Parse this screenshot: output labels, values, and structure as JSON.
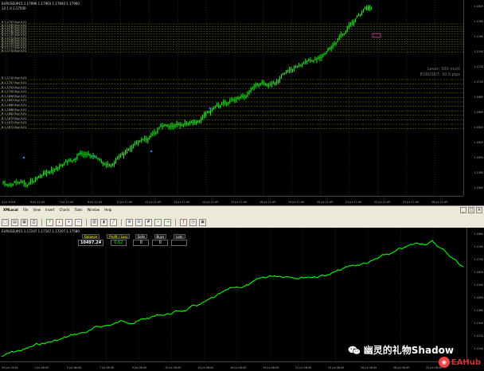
{
  "top_chart": {
    "symbol_line": "EURUSD,M15 1.17896 1.17903 1.17893 1.17900",
    "symbol_line2": "13.1 d  1.17500",
    "levels": [
      {
        "label": "B 1.1752 Buy 0.01"
      },
      {
        "label": "B 1.1749 Buy 0.01"
      },
      {
        "label": "B 1.1745 Buy 0.01"
      },
      {
        "label": "B 1.1742 Buy 0.01"
      },
      {
        "label": "B 1.1738 Buy 0.01"
      },
      {
        "label": "B 1.1735 Buy 0.01"
      },
      {
        "label": "B 1.1731 Buy 0.01"
      },
      {
        "label": "B 1.1728 Buy 0.01"
      },
      {
        "label": "B 1.1724 Buy 0.01"
      },
      {
        "label": "B 1.1721 Buy 0.01"
      },
      {
        "label": "B 1.1717 Buy 0.01"
      },
      {
        "label": "B 1.1714 Buy 0.01"
      },
      {
        "label": "B 1.1710 Buy 0.01"
      },
      {
        "label": "B 1.1707 Buy 0.01"
      },
      {
        "label": "B 1.1703 Buy 0.01"
      },
      {
        "label": "B 1.1700 Buy 0.01"
      },
      {
        "label": "B 1.1696 Buy 0.01"
      },
      {
        "label": "B 1.1693 Buy 0.01"
      },
      {
        "label": "B 1.1689 Buy 0.01"
      },
      {
        "label": "B 1.1686 Buy 0.01"
      },
      {
        "label": "B 1.1682 Buy 0.01"
      },
      {
        "label": "B 1.1679 Buy 0.01"
      },
      {
        "label": "B 1.1675 Buy 0.01"
      },
      {
        "label": "B 1.1672 Buy 0.01"
      }
    ],
    "overlay_line1": "Lever: 500 multi",
    "overlay_line2": "EURUSD7: 30.0 pips",
    "price_ticks": [
      "1.1800",
      "1.1780",
      "1.1760",
      "1.1740",
      "1.1720",
      "1.1700",
      "1.1680",
      "1.1660",
      "1.1640",
      "1.1620",
      "1.1600",
      "1.1580",
      "1.1560"
    ],
    "time_ticks": [
      "4 Jul 2016",
      "6 Jul 11:45",
      "7 Jul 11:45",
      "8 Jul 11:45",
      "11 Jul 11:45",
      "12 Jul 11:45",
      "13 Jul 11:45",
      "14 Jul 11:45",
      "15 Jul 11:45",
      "18 Jul 11:45",
      "19 Jul 11:45",
      "20 Jul 11:45",
      "21 Jul 11:45",
      "22 Jul 11:45",
      "25 Jul 11:45",
      "26 Jul 11:45"
    ],
    "colors": {
      "candles": "#00ff00",
      "grid": "#2a5a2a",
      "level": "#a6a61a",
      "blue_marker": "#3b6cff",
      "pink_marker": "#d033b0"
    }
  },
  "toolbar": {
    "window_title": "XMLocal",
    "menu": [
      "File",
      "View",
      "Insert",
      "Charts",
      "Tools",
      "Window",
      "Help"
    ],
    "icons": [
      "new-chart-icon",
      "open-icon",
      "save-icon",
      "print-icon",
      "arrow-up-icon",
      "arrow-down-icon",
      "plus-icon",
      "minus-icon",
      "bar-chart-icon",
      "candle-chart-icon",
      "line-chart-icon",
      "zoom-in-icon",
      "zoom-out-icon",
      "grid-icon",
      "autoscroll-icon",
      "shift-icon",
      "indicators-icon",
      "periods-icon",
      "templates-icon"
    ],
    "icon_glyphs": [
      "▢",
      "▤",
      "▦",
      "⎙",
      "↑",
      "↓",
      "+",
      "−",
      "▥",
      "▮",
      "╱",
      "⊕",
      "⊖",
      "#",
      "»",
      "⇥",
      "ƒ",
      "◷",
      "▣"
    ]
  },
  "bottom_chart": {
    "symbol_line": "EURUSD,M15 1.17247 1.17547 1.17207 1.17580",
    "stats": [
      {
        "label": "Balance",
        "value": "10497.24",
        "kind": "balance"
      },
      {
        "label": "Profit / Loss",
        "value": "0.62",
        "kind": "profit"
      },
      {
        "label": "Sells",
        "value": "0",
        "kind": "plain"
      },
      {
        "label": "Buys",
        "value": "0",
        "kind": "plain"
      },
      {
        "label": "Lots",
        "value": "",
        "kind": "plain"
      }
    ],
    "price_ticks": [
      "1.1860",
      "1.1780",
      "1.1700",
      "1.1620",
      "1.1540",
      "1.1460",
      "1.1380",
      "1.1300",
      "1.1220",
      "1.1140"
    ],
    "time_ticks": [
      "29 Jun 2016",
      "1 Jul 08:45",
      "5 Jul 08:45",
      "7 Jul 08:45",
      "9 Jul 08:45",
      "12 Jul 08:45",
      "14 Jul 08:45",
      "16 Jul 08:45",
      "19 Jul 08:45",
      "21 Jul 08:45",
      "23 Jul 08:45",
      "26 Jul 08:45",
      "28 Jul 08:45",
      "31 Jul 08:45"
    ],
    "colors": {
      "line": "#00ff00",
      "grid": "#3a3a3a"
    }
  },
  "watermark": {
    "text": "幽灵的礼物Shadow",
    "brand": "EAHub"
  }
}
